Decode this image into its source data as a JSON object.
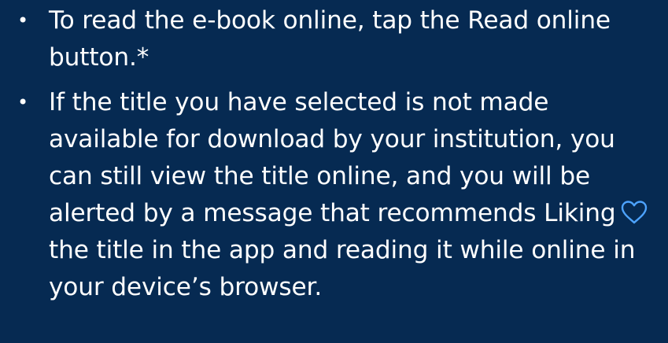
{
  "bullet_symbol": "•",
  "items": [
    {
      "text": "To read the e-book online, tap the Read online button.*"
    },
    {
      "text_before_icon": "If the title you have selected is not made available for download by your institution, you can still view the title online, and you will be alerted by a message that recommends Liking",
      "icon": "heart-outline-icon",
      "text_after_icon": "the title in the app and reading it while online in your device’s browser."
    }
  ],
  "colors": {
    "background": "#062a52",
    "text": "#ffffff",
    "heart_icon": "#4da3ff"
  }
}
